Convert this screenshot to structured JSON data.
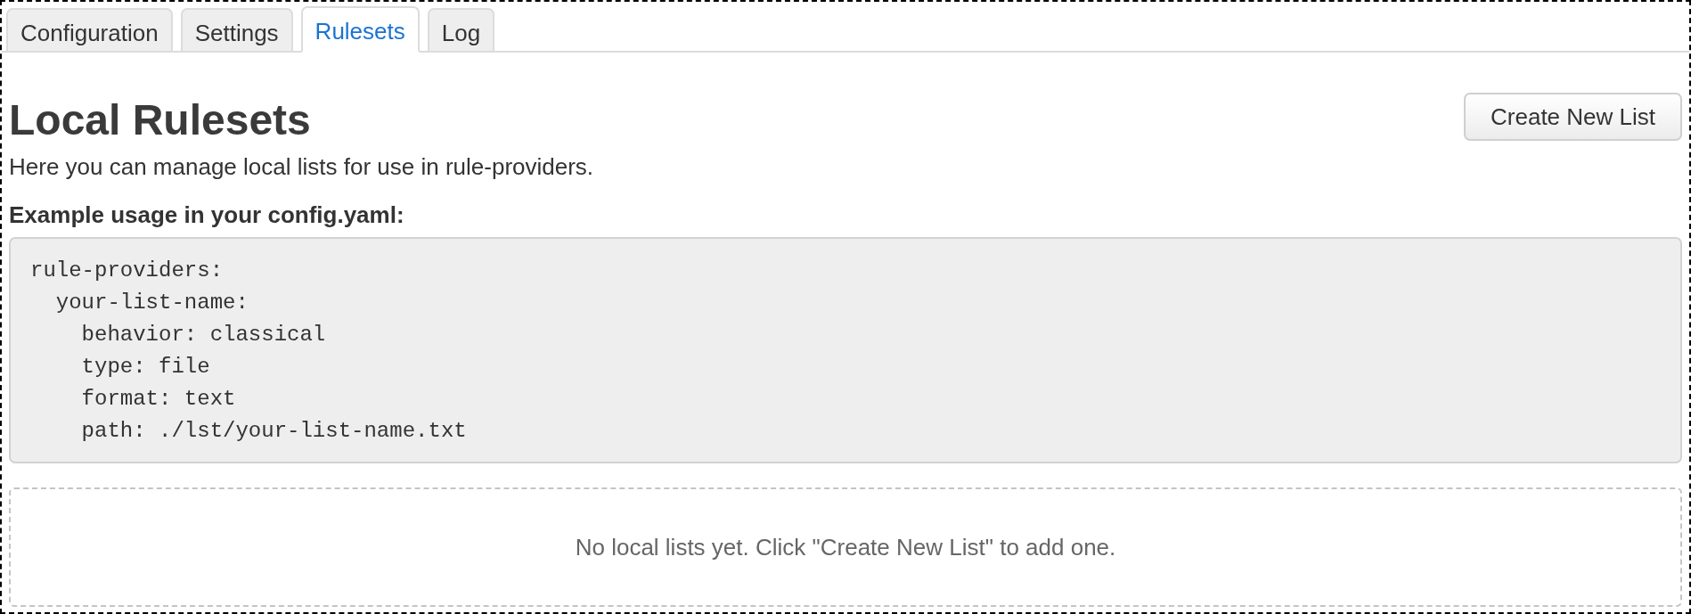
{
  "tabs": [
    {
      "label": "Configuration",
      "selected": false
    },
    {
      "label": "Settings",
      "selected": false
    },
    {
      "label": "Rulesets",
      "selected": true
    },
    {
      "label": "Log",
      "selected": false
    }
  ],
  "header": {
    "title": "Local Rulesets",
    "button": "Create New List"
  },
  "description": "Here you can manage local lists for use in rule-providers.",
  "example": {
    "heading": "Example usage in your config.yaml:",
    "code": "rule-providers:\n  your-list-name:\n    behavior: classical\n    type: file\n    format: text\n    path: ./lst/your-list-name.txt"
  },
  "empty_state": {
    "message": "No local lists yet. Click \"Create New List\" to add one."
  }
}
